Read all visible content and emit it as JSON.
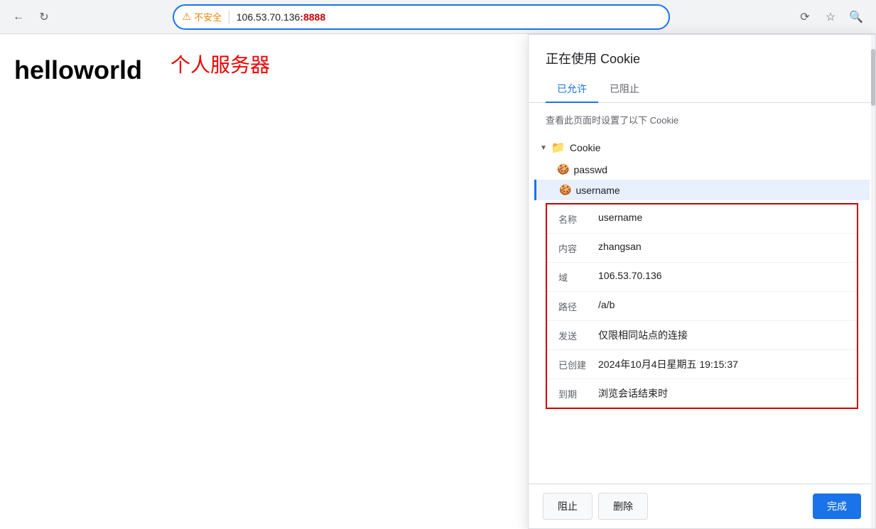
{
  "browser": {
    "security_warning": "不安全",
    "url_plain": "106.53.70.136",
    "url_port": ":8888",
    "back_icon": "←",
    "refresh_icon": "↻",
    "reload_icon": "⟳",
    "star_icon": "☆",
    "search_icon": "🔍"
  },
  "page": {
    "title": "helloworld",
    "server_label": "个人服务器"
  },
  "popup": {
    "title": "正在使用 Cookie",
    "tab_allowed": "已允许",
    "tab_blocked": "已阻止",
    "description": "查看此页面时设置了以下 Cookie",
    "cookie_folder": "Cookie",
    "items": [
      {
        "name": "passwd",
        "selected": false
      },
      {
        "name": "username",
        "selected": true
      }
    ],
    "details": {
      "rows": [
        {
          "label": "名称",
          "value": "username"
        },
        {
          "label": "内容",
          "value": "zhangsan"
        },
        {
          "label": "域",
          "value": "106.53.70.136"
        },
        {
          "label": "路径",
          "value": "/a/b"
        },
        {
          "label": "发送",
          "value": "仅限相同站点的连接"
        },
        {
          "label": "已创建",
          "value": "2024年10月4日星期五 19:15:37"
        },
        {
          "label": "到期",
          "value": "浏览会话结束时"
        }
      ]
    },
    "footer": {
      "block_btn": "阻止",
      "delete_btn": "删除",
      "done_btn": "完成"
    }
  }
}
